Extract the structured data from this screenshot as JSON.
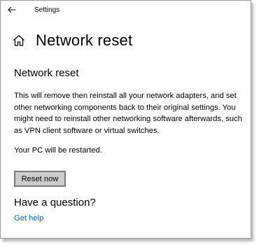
{
  "window": {
    "title": "Settings"
  },
  "header": {
    "title": "Network reset",
    "home_icon": "home-icon",
    "back_icon": "back-arrow-icon"
  },
  "section": {
    "title": "Network reset",
    "description": "This will remove then reinstall all your network adapters, and set other networking components back to their original settings. You might need to reinstall other networking software afterwards, such as VPN client software or virtual switches.",
    "restart_note": "Your PC will be restarted.",
    "reset_button_label": "Reset now"
  },
  "help": {
    "heading": "Have a question?",
    "link_label": "Get help"
  },
  "colors": {
    "link": "#0067b8",
    "button_bg": "#cccccc",
    "button_border": "#7a7a7a"
  }
}
